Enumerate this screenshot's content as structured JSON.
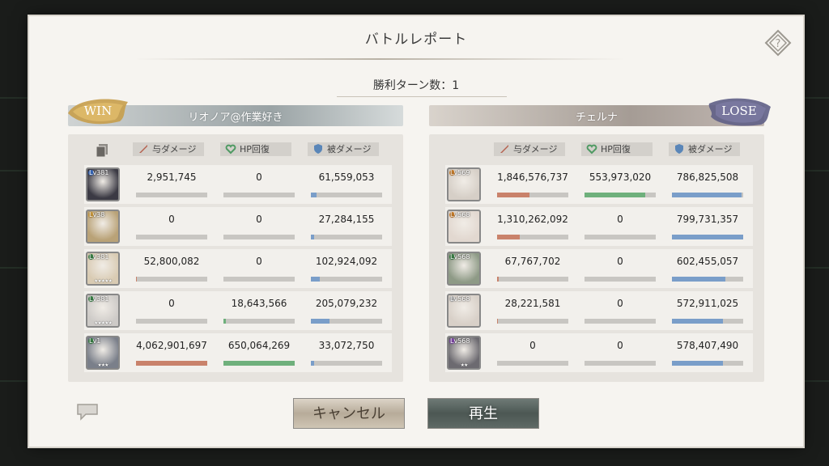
{
  "dialog": {
    "title": "バトルレポート",
    "turn_label": "勝利ターン数：1",
    "help_icon": "help-diamond-icon"
  },
  "columns": {
    "damage_dealt": "与ダメージ",
    "hp_recovery": "HP回復",
    "damage_taken": "被ダメージ"
  },
  "left": {
    "result": "WIN",
    "player_name": "リオノア@作業好き",
    "units": [
      {
        "level": "Lv381",
        "element_color": "#3a6fc9",
        "stars": "",
        "dealt": "2,951,745",
        "heal": "0",
        "taken": "61,559,053",
        "dealt_ratio": 0.0,
        "heal_ratio": 0.0,
        "taken_ratio": 0.08,
        "portrait": "#3b3a44"
      },
      {
        "level": "Lv38",
        "element_color": "#d9a441",
        "stars": "",
        "dealt": "0",
        "heal": "0",
        "taken": "27,284,155",
        "dealt_ratio": 0.0,
        "heal_ratio": 0.0,
        "taken_ratio": 0.04,
        "portrait": "#b9a277"
      },
      {
        "level": "Lv381",
        "element_color": "#3f8a4c",
        "stars": "★★★★★",
        "dealt": "52,800,082",
        "heal": "0",
        "taken": "102,924,092",
        "dealt_ratio": 0.01,
        "heal_ratio": 0.0,
        "taken_ratio": 0.13,
        "portrait": "#d9cbb3"
      },
      {
        "level": "Lv381",
        "element_color": "#3f8a4c",
        "stars": "★★★★★",
        "dealt": "0",
        "heal": "18,643,566",
        "taken": "205,079,232",
        "dealt_ratio": 0.0,
        "heal_ratio": 0.03,
        "taken_ratio": 0.26,
        "portrait": "#cdcac7"
      },
      {
        "level": "Lv1",
        "element_color": "#3f8a4c",
        "stars": "★★★",
        "dealt": "4,062,901,697",
        "heal": "650,064,269",
        "taken": "33,072,750",
        "dealt_ratio": 1.0,
        "heal_ratio": 1.0,
        "taken_ratio": 0.04,
        "portrait": "#7a7f8a"
      }
    ]
  },
  "right": {
    "result": "LOSE",
    "player_name": "チェルナ",
    "units": [
      {
        "level": "Lv569",
        "element_color": "#d6862e",
        "stars": "",
        "dealt": "1,846,576,737",
        "heal": "553,973,020",
        "taken": "786,825,508",
        "dealt_ratio": 0.45,
        "heal_ratio": 0.85,
        "taken_ratio": 0.98,
        "portrait": "#d6cfc7"
      },
      {
        "level": "Lv568",
        "element_color": "#d6862e",
        "stars": "",
        "dealt": "1,310,262,092",
        "heal": "0",
        "taken": "799,731,357",
        "dealt_ratio": 0.32,
        "heal_ratio": 0.0,
        "taken_ratio": 1.0,
        "portrait": "#e2d8d0"
      },
      {
        "level": "Lv568",
        "element_color": "#3f8a4c",
        "stars": "",
        "dealt": "67,767,702",
        "heal": "0",
        "taken": "602,455,057",
        "dealt_ratio": 0.02,
        "heal_ratio": 0.0,
        "taken_ratio": 0.75,
        "portrait": "#8e9a86"
      },
      {
        "level": "Lv568",
        "element_color": "#bfbfbf",
        "stars": "",
        "dealt": "28,221,581",
        "heal": "0",
        "taken": "572,911,025",
        "dealt_ratio": 0.01,
        "heal_ratio": 0.0,
        "taken_ratio": 0.72,
        "portrait": "#d8d0c8"
      },
      {
        "level": "Lv568",
        "element_color": "#8a4fb5",
        "stars": "★★",
        "dealt": "0",
        "heal": "0",
        "taken": "578,407,490",
        "dealt_ratio": 0.0,
        "heal_ratio": 0.0,
        "taken_ratio": 0.72,
        "portrait": "#6c6a70"
      }
    ]
  },
  "buttons": {
    "cancel_label": "キャンセル",
    "replay_label": "再生"
  },
  "colors": {
    "dealt_bar": "#c9826b",
    "heal_bar": "#6fb07c",
    "taken_bar": "#7a9ec9"
  }
}
